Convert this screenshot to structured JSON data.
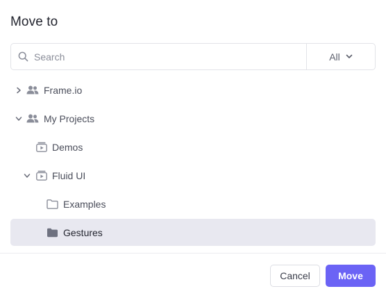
{
  "dialog": {
    "title": "Move to"
  },
  "search": {
    "placeholder": "Search",
    "value": "",
    "filter_value": "All"
  },
  "tree": [
    {
      "label": "Frame.io",
      "icon": "team-icon",
      "toggle": "collapsed",
      "depth": 0,
      "selected": false
    },
    {
      "label": "My Projects",
      "icon": "team-icon",
      "toggle": "expanded",
      "depth": 0,
      "selected": false
    },
    {
      "label": "Demos",
      "icon": "project-icon",
      "toggle": "none",
      "depth": 1,
      "selected": false
    },
    {
      "label": "Fluid UI",
      "icon": "project-icon",
      "toggle": "expanded",
      "depth": 1,
      "selected": false
    },
    {
      "label": "Examples",
      "icon": "folder-outline-icon",
      "toggle": "none",
      "depth": 2,
      "selected": false
    },
    {
      "label": "Gestures",
      "icon": "folder-filled-icon",
      "toggle": "none",
      "depth": 2,
      "selected": true
    }
  ],
  "footer": {
    "cancel_label": "Cancel",
    "move_label": "Move"
  },
  "colors": {
    "accent": "#6b63f5",
    "selected_row": "#e8e8f0",
    "icon": "#8a8d99",
    "border": "#e2e3e8"
  }
}
